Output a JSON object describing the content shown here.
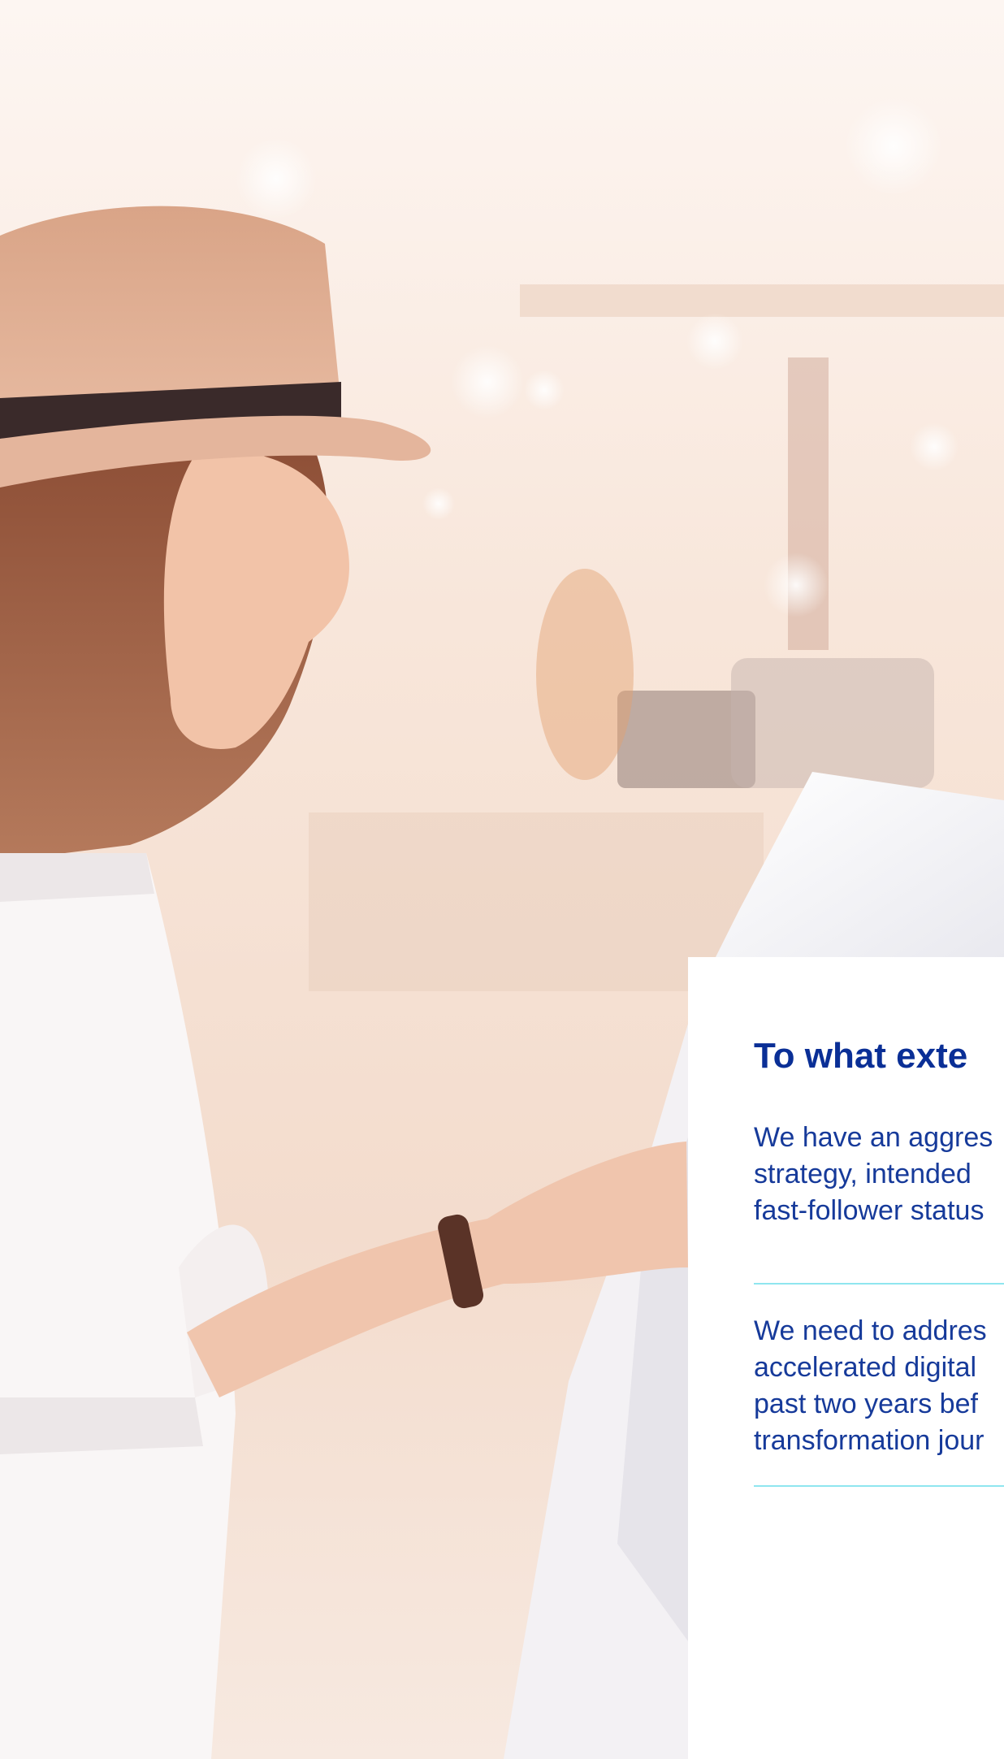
{
  "survey": {
    "question_title": "To what exte",
    "options": [
      {
        "text": "We have an aggres\nstrategy, intended\nfast-follower status"
      },
      {
        "text": "We need to addres\naccelerated digital\npast two years bef\ntransformation jour"
      }
    ]
  },
  "photo": {
    "subject": "woman-touching-kiosk-screen",
    "icons": [
      "hat",
      "watch",
      "kiosk-screen"
    ]
  },
  "colors": {
    "title": "#0a2f96",
    "body_text": "#163a9a",
    "divider": "#8fe6ef",
    "card": "#ffffff",
    "background": "#f6e7de"
  }
}
